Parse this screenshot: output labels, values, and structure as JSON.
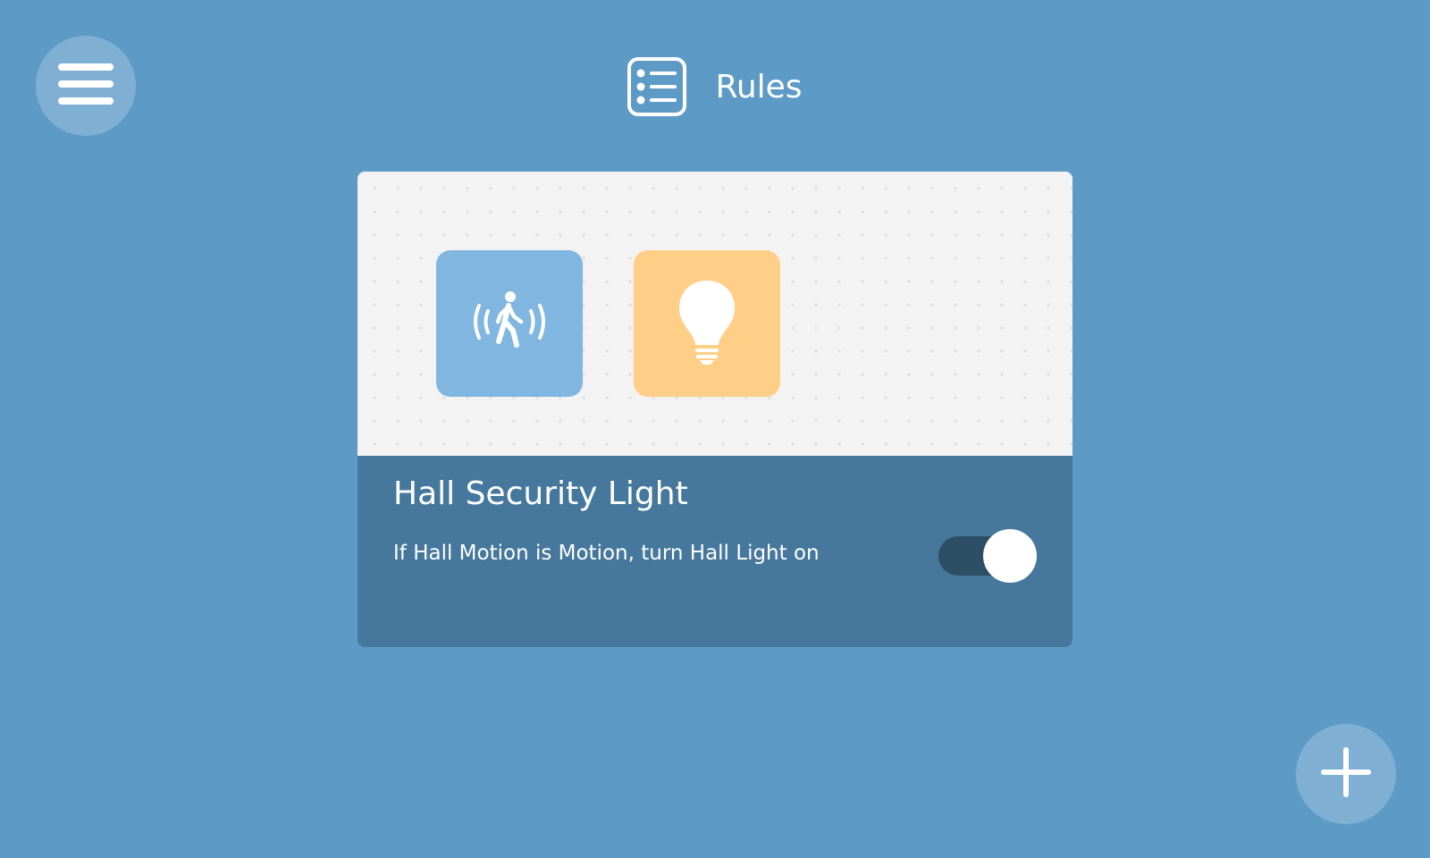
{
  "header": {
    "title": "Rules",
    "icon": "rules-list-icon"
  },
  "menu": {
    "icon": "hamburger-menu-icon"
  },
  "rule": {
    "name": "Hall Security Light",
    "description": "If Hall Motion is Motion, turn Hall Light on",
    "enabled": true,
    "trigger_icon": "motion-sensor-icon",
    "action_icon": "light-bulb-icon"
  },
  "add_button": {
    "icon": "plus-icon"
  },
  "colors": {
    "background": "#5d9bc6",
    "button": "#7fb0d4",
    "card_top": "#f3f3f3",
    "card_bottom": "#46789d",
    "trigger_tile": "#80b6e0",
    "action_tile": "#ffcf88",
    "toggle_track": "#2e4e65"
  }
}
